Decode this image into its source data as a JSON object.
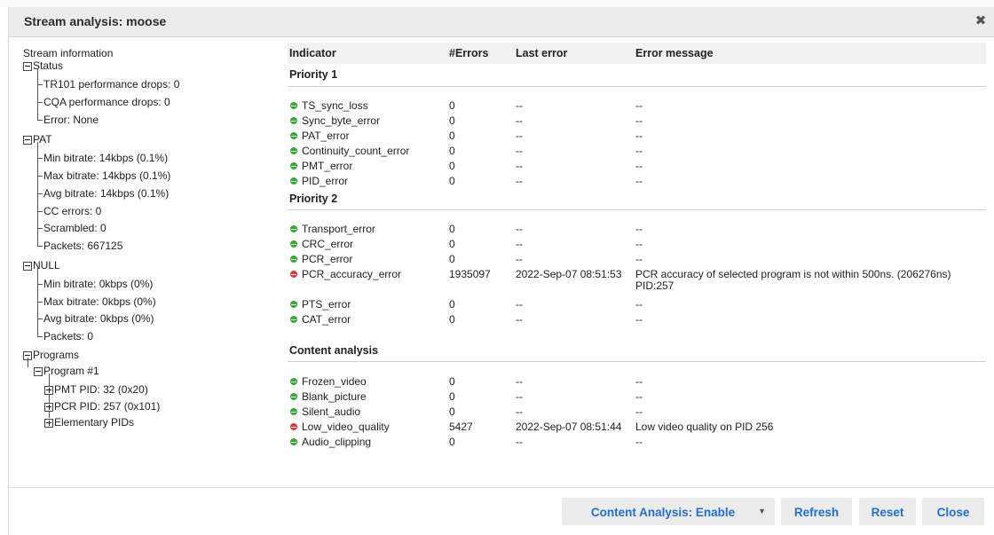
{
  "dialog": {
    "title": "Stream analysis: moose",
    "close_symbol": "✖"
  },
  "colors": {
    "ok": "#3aa83a",
    "error": "#e03b3b",
    "button_text": "#1f6fd1",
    "header_bg": "#f1f1f1"
  },
  "tree": {
    "root_label": "Stream information",
    "status": {
      "label": "Status",
      "items": [
        "TR101 performance drops: 0",
        "CQA performance drops: 0",
        "Error: None"
      ]
    },
    "pat": {
      "label": "PAT",
      "items": [
        "Min bitrate: 14kbps (0.1%)",
        "Max bitrate: 14kbps (0.1%)",
        "Avg bitrate: 14kbps (0.1%)",
        "CC errors: 0",
        "Scrambled: 0",
        "Packets: 667125"
      ]
    },
    "null": {
      "label": "NULL",
      "items": [
        "Min bitrate: 0kbps (0%)",
        "Max bitrate: 0kbps (0%)",
        "Avg bitrate: 0kbps (0%)",
        "Packets: 0"
      ]
    },
    "programs": {
      "label": "Programs",
      "program": "Program #1",
      "children": [
        "PMT PID: 32 (0x20)",
        "PCR PID: 257 (0x101)",
        "Elementary PIDs"
      ]
    }
  },
  "table": {
    "headers": {
      "indicator": "Indicator",
      "errors": "#Errors",
      "last_error": "Last error",
      "message": "Error message"
    },
    "sections": [
      {
        "title": "Priority 1",
        "rows": [
          {
            "status": "ok",
            "indicator": "TS_sync_loss",
            "errors": "0",
            "last": "--",
            "msg": "--"
          },
          {
            "status": "ok",
            "indicator": "Sync_byte_error",
            "errors": "0",
            "last": "--",
            "msg": "--"
          },
          {
            "status": "ok",
            "indicator": "PAT_error",
            "errors": "0",
            "last": "--",
            "msg": "--"
          },
          {
            "status": "ok",
            "indicator": "Continuity_count_error",
            "errors": "0",
            "last": "--",
            "msg": "--"
          },
          {
            "status": "ok",
            "indicator": "PMT_error",
            "errors": "0",
            "last": "--",
            "msg": "--"
          },
          {
            "status": "ok",
            "indicator": "PID_error",
            "errors": "0",
            "last": "--",
            "msg": "--"
          }
        ]
      },
      {
        "title": "Priority 2",
        "rows": [
          {
            "status": "ok",
            "indicator": "Transport_error",
            "errors": "0",
            "last": "--",
            "msg": "--"
          },
          {
            "status": "ok",
            "indicator": "CRC_error",
            "errors": "0",
            "last": "--",
            "msg": "--"
          },
          {
            "status": "ok",
            "indicator": "PCR_error",
            "errors": "0",
            "last": "--",
            "msg": "--"
          },
          {
            "status": "error",
            "indicator": "PCR_accuracy_error",
            "errors": "1935097",
            "last": "2022-Sep-07 08:51:53",
            "msg": "PCR accuracy of selected program is not within 500ns. (206276ns) PID:257"
          },
          {
            "status": "ok",
            "indicator": "PTS_error",
            "errors": "0",
            "last": "--",
            "msg": "--"
          },
          {
            "status": "ok",
            "indicator": "CAT_error",
            "errors": "0",
            "last": "--",
            "msg": "--"
          }
        ]
      },
      {
        "title": "Content analysis",
        "rows": [
          {
            "status": "ok",
            "indicator": "Frozen_video",
            "errors": "0",
            "last": "--",
            "msg": "--"
          },
          {
            "status": "ok",
            "indicator": "Blank_picture",
            "errors": "0",
            "last": "--",
            "msg": "--"
          },
          {
            "status": "ok",
            "indicator": "Silent_audio",
            "errors": "0",
            "last": "--",
            "msg": "--"
          },
          {
            "status": "error",
            "indicator": "Low_video_quality",
            "errors": "5427",
            "last": "2022-Sep-07 08:51:44",
            "msg": "Low video quality on PID 256"
          },
          {
            "status": "ok",
            "indicator": "Audio_clipping",
            "errors": "0",
            "last": "--",
            "msg": "--"
          }
        ]
      }
    ]
  },
  "footer": {
    "content_analysis_label": "Content Analysis: Enable",
    "refresh_label": "Refresh",
    "reset_label": "Reset",
    "close_label": "Close"
  }
}
